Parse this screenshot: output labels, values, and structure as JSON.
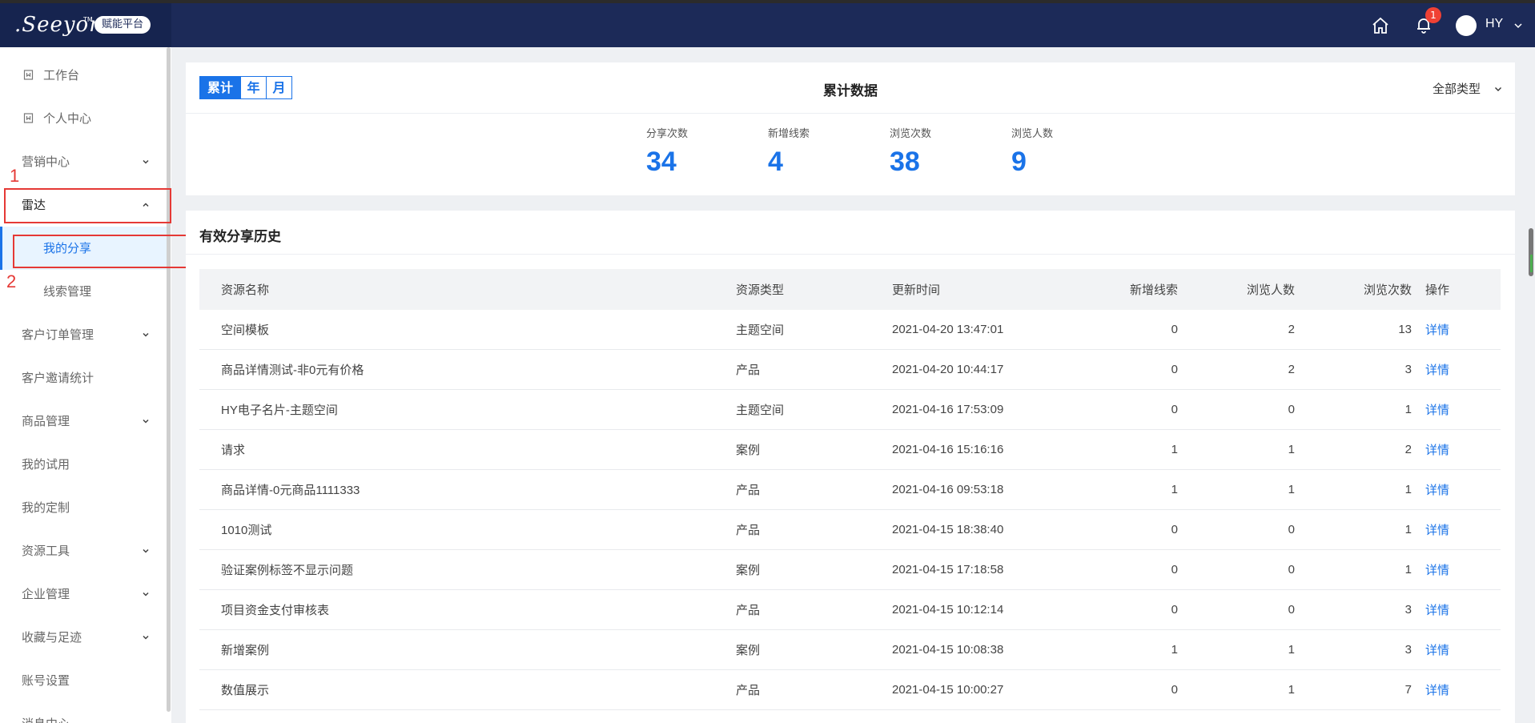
{
  "header": {
    "logo_text": ".Seeyon",
    "logo_tm": "TM",
    "platform_badge": "赋能平台",
    "notification_count": "1",
    "user_name": "HY"
  },
  "sidebar": {
    "items": [
      {
        "label": "工作台"
      },
      {
        "label": "个人中心"
      },
      {
        "label": "营销中心"
      },
      {
        "label": "雷达"
      },
      {
        "label": "我的分享"
      },
      {
        "label": "线索管理"
      },
      {
        "label": "客户订单管理"
      },
      {
        "label": "客户邀请统计"
      },
      {
        "label": "商品管理"
      },
      {
        "label": "我的试用"
      },
      {
        "label": "我的定制"
      },
      {
        "label": "资源工具"
      },
      {
        "label": "企业管理"
      },
      {
        "label": "收藏与足迹"
      },
      {
        "label": "账号设置"
      },
      {
        "label": "消息中心"
      }
    ],
    "annotations": [
      "1",
      "2"
    ]
  },
  "summary": {
    "tabs": [
      "累计",
      "年",
      "月"
    ],
    "active_tab": "累计",
    "title": "累计数据",
    "type_filter": "全部类型",
    "stats": [
      {
        "label": "分享次数",
        "value": "34"
      },
      {
        "label": "新增线索",
        "value": "4"
      },
      {
        "label": "浏览次数",
        "value": "38"
      },
      {
        "label": "浏览人数",
        "value": "9"
      }
    ]
  },
  "history": {
    "title": "有效分享历史",
    "columns": [
      "资源名称",
      "资源类型",
      "更新时间",
      "新增线索",
      "浏览人数",
      "浏览次数",
      "操作"
    ],
    "rows": [
      {
        "name": "空间模板",
        "type": "主题空间",
        "time": "2021-04-20 13:47:01",
        "new_leads": "0",
        "visitors": "2",
        "views": "13",
        "op": "详情"
      },
      {
        "name": "商品详情测试-非0元有价格",
        "type": "产品",
        "time": "2021-04-20 10:44:17",
        "new_leads": "0",
        "visitors": "2",
        "views": "3",
        "op": "详情"
      },
      {
        "name": "HY电子名片-主题空间",
        "type": "主题空间",
        "time": "2021-04-16 17:53:09",
        "new_leads": "0",
        "visitors": "0",
        "views": "1",
        "op": "详情"
      },
      {
        "name": "请求",
        "type": "案例",
        "time": "2021-04-16 15:16:16",
        "new_leads": "1",
        "visitors": "1",
        "views": "2",
        "op": "详情"
      },
      {
        "name": "商品详情-0元商品1111333",
        "type": "产品",
        "time": "2021-04-16 09:53:18",
        "new_leads": "1",
        "visitors": "1",
        "views": "1",
        "op": "详情"
      },
      {
        "name": "1010测试",
        "type": "产品",
        "time": "2021-04-15 18:38:40",
        "new_leads": "0",
        "visitors": "0",
        "views": "1",
        "op": "详情"
      },
      {
        "name": "验证案例标签不显示问题",
        "type": "案例",
        "time": "2021-04-15 17:18:58",
        "new_leads": "0",
        "visitors": "0",
        "views": "1",
        "op": "详情"
      },
      {
        "name": "项目资金支付审核表",
        "type": "产品",
        "time": "2021-04-15 10:12:14",
        "new_leads": "0",
        "visitors": "0",
        "views": "3",
        "op": "详情"
      },
      {
        "name": "新增案例",
        "type": "案例",
        "time": "2021-04-15 10:08:38",
        "new_leads": "1",
        "visitors": "1",
        "views": "3",
        "op": "详情"
      },
      {
        "name": "数值展示",
        "type": "产品",
        "time": "2021-04-15 10:00:27",
        "new_leads": "0",
        "visitors": "1",
        "views": "7",
        "op": "详情"
      }
    ]
  },
  "colors": {
    "header": "#1c2a58",
    "accent": "#1a73e8",
    "annotation": "#e53935"
  }
}
